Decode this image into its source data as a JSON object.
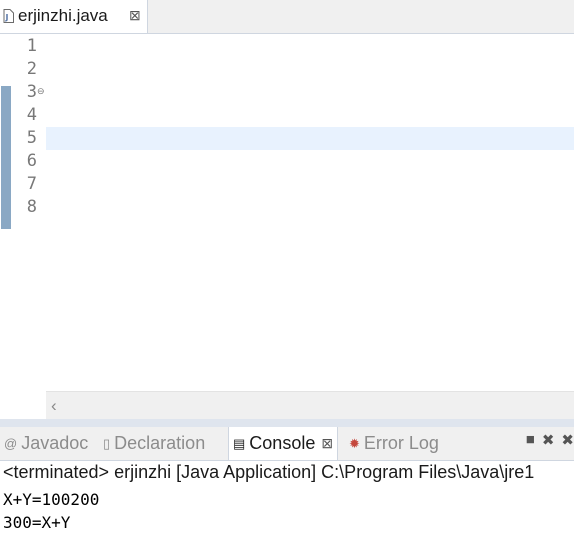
{
  "editor_tab": {
    "title": "erjinzhi.java",
    "close_glyph": "⊠",
    "icon": "java-file-icon"
  },
  "code": {
    "line_numbers": [
      "1",
      "2",
      "3",
      "4",
      "5",
      "6",
      "7",
      "8"
    ],
    "fold_marker": "⊖",
    "current_line": 5
  },
  "panel_tabs": [
    {
      "icon": "javadoc-icon",
      "icon_glyph": "@",
      "label": "Javadoc"
    },
    {
      "icon": "declaration-icon",
      "icon_glyph": "▯",
      "label": "Declaration"
    },
    {
      "icon": "console-icon",
      "icon_glyph": "▤",
      "label": "Console",
      "active": true,
      "close_glyph": "⊠"
    },
    {
      "icon": "error-log-icon",
      "icon_glyph": "✹",
      "label": "Error Log"
    }
  ],
  "toolbar": {
    "terminate_glyph": "■",
    "remove_glyph": "✖",
    "remove_all_glyph": "✖"
  },
  "console": {
    "header": "<terminated> erjinzhi [Java Application] C:\\Program Files\\Java\\jre1",
    "output": [
      "X+Y=100200",
      "300=X+Y"
    ]
  },
  "colors": {
    "keyword": "#7f0055",
    "string": "#2a00ff",
    "field": "#0000c0",
    "local_variable": "#6a3e3e",
    "current_line": "#e8f2fe",
    "change_marker": "#8aa8c4"
  }
}
